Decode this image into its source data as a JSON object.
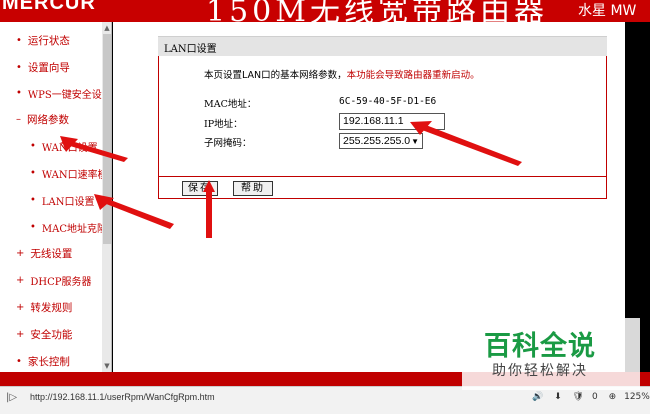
{
  "header": {
    "brand": "MERCUR",
    "product": "150M无线宽带路由器",
    "series": "水星 MW"
  },
  "sidebar": {
    "items": [
      {
        "label": "运行状态",
        "bullet": "•"
      },
      {
        "label": "设置向导",
        "bullet": "•"
      },
      {
        "label": "WPS一键安全设",
        "bullet": "•"
      },
      {
        "label": "网络参数",
        "bullet": "–"
      },
      {
        "label": "WAN口设置",
        "bullet": "•"
      },
      {
        "label": "WAN口速率模",
        "bullet": "•"
      },
      {
        "label": "LAN口设置",
        "bullet": "•"
      },
      {
        "label": "MAC地址克隆",
        "bullet": "•"
      },
      {
        "label": "无线设置",
        "bullet": "+"
      },
      {
        "label": "DHCP服务器",
        "bullet": "+"
      },
      {
        "label": "转发规则",
        "bullet": "+"
      },
      {
        "label": "安全功能",
        "bullet": "+"
      },
      {
        "label": "家长控制",
        "bullet": "•"
      }
    ],
    "scroll_up": "▲",
    "scroll_down": "▼"
  },
  "main": {
    "panel_title": "LAN口设置",
    "intro": "本页设置LAN口的基本网络参数，",
    "intro_warning": "本功能会导致路由器重新启动。",
    "mac_label": "MAC地址：",
    "mac_value": "6C-59-40-5F-D1-E6",
    "ip_label": "IP地址：",
    "ip_value": "192.168.11.1",
    "mask_label": "子网掩码：",
    "mask_value": "255.255.255.0",
    "mask_arrow": "▼",
    "save_label": "保存",
    "help_label": "帮助"
  },
  "status_bar": {
    "url_icon": "|▷",
    "url": "http://192.168.11.1/userRpm/WanCfgRpm.htm",
    "zoom": "125%",
    "count": "0"
  },
  "watermark": {
    "title": "百科全说",
    "subtitle": "助你轻松解决"
  },
  "colors": {
    "accent_red": "#c80000",
    "watermark_green": "#1a9a44"
  }
}
